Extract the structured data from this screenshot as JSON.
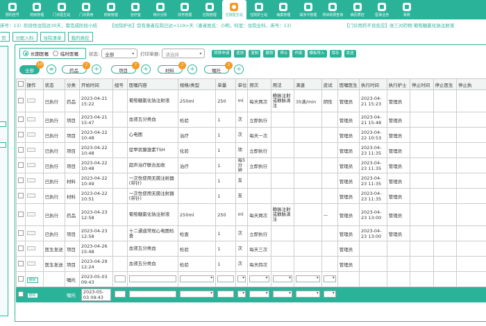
{
  "nav": [
    {
      "label": "预约挂号",
      "active": false
    },
    {
      "label": "药房管理",
      "active": false
    },
    {
      "label": "门诊医生站",
      "active": false
    },
    {
      "label": "门诊费用",
      "active": false
    },
    {
      "label": "药房管理",
      "active": false
    },
    {
      "label": "治疗室",
      "active": false
    },
    {
      "label": "统计分析",
      "active": false
    },
    {
      "label": "财务管理",
      "active": false
    },
    {
      "label": "住院管理",
      "active": false
    },
    {
      "label": "住院医生站",
      "active": true
    },
    {
      "label": "住院护士站",
      "active": false
    },
    {
      "label": "病案管理",
      "active": false
    },
    {
      "label": "减涉卡管理",
      "active": false
    },
    {
      "label": "项目收费查询",
      "active": false
    },
    {
      "label": "病历质控",
      "active": false
    },
    {
      "label": "医保业务",
      "active": false
    },
    {
      "label": "系统",
      "active": false
    }
  ],
  "ticker": {
    "msg1": "床号：13）阶段性往院达30天，需完成阶段小结",
    "msg2": "【住院护长】您有患者在院已达<119>天（患者姓名：小明，科室：住院全科，床号：13）",
    "msg3": "【门诊用药不良反应】张三对药物:葡萄糖氯化钠注射液"
  },
  "toolbar": [
    "页",
    "分配入科",
    "住院清单",
    "我的质控"
  ],
  "filter": {
    "long_term": "长期医嘱",
    "temporary": "临时医嘱",
    "status_label": "状态:",
    "status_value": "全部",
    "print_label": "打印单据:",
    "print_placeholder": "请选择",
    "actions": [
      "转移申请",
      "医技",
      "复制",
      "撤销",
      "停止",
      "作废",
      "模板导入",
      "保存",
      "发送"
    ]
  },
  "pills": {
    "all": {
      "label": "全部",
      "count": "13"
    },
    "drug": {
      "label": "药品",
      "count": "2"
    },
    "item": {
      "label": "项目",
      "count": "7"
    },
    "material": {
      "label": "材料",
      "count": "2"
    },
    "entrust": {
      "label": "嘱托",
      "count": "2"
    }
  },
  "columns": [
    "操作",
    "状态",
    "分类",
    "开始时间",
    "组号",
    "医嘱内容",
    "规格/类型",
    "单量",
    "单位",
    "频次",
    "用法",
    "滴速",
    "皮试",
    "医嘱医生",
    "执行时间",
    "执行护士",
    "停止时间",
    "停止医生",
    "停止执"
  ],
  "rows": [
    {
      "status": "已执行",
      "category": "药品",
      "start": "2023-04-21 15:22",
      "content": "葡萄糖氯化钠注射液",
      "spec": "250ml",
      "qty": "250",
      "unit": "ml",
      "freq": "每天两次",
      "usage": "静脉注射或静脉滴注",
      "speed": "35滴/min",
      "skin": "阴性",
      "doctor": "管理员",
      "exec_time": "2023-04-21 15:23",
      "nurse": "管理员"
    },
    {
      "status": "已执行",
      "category": "项目",
      "start": "2023-04-21 15:47",
      "content": "血液五分类血",
      "spec": "检验",
      "qty": "1",
      "unit": "次",
      "freq": "立即执行",
      "usage": "",
      "speed": "",
      "skin": "",
      "doctor": "管理员",
      "exec_time": "2023-04-21 15:48",
      "nurse": "管理员"
    },
    {
      "status": "已执行",
      "category": "项目",
      "start": "2023-04-22 10:48",
      "content": "心电图",
      "spec": "治疗",
      "qty": "1",
      "unit": "次",
      "freq": "每天一次",
      "usage": "",
      "speed": "",
      "skin": "",
      "doctor": "管理员",
      "exec_time": "2023-04-22 10:53",
      "nurse": "管理员"
    },
    {
      "status": "已执行",
      "category": "项目",
      "start": "2023-04-22 10:48",
      "content": "促甲状腺激素TSH",
      "spec": "化验",
      "qty": "1",
      "unit": "项",
      "freq": "立即执行",
      "usage": "",
      "speed": "",
      "skin": "",
      "doctor": "管理员",
      "exec_time": "2023-04-23 11:35",
      "nurse": "管理员"
    },
    {
      "status": "已执行",
      "category": "项目",
      "start": "2023-04-22 10:48",
      "content": "超声治疗联合加收",
      "spec": "治疗",
      "qty": "1",
      "unit": "每5分钟",
      "freq": "立即执行",
      "usage": "",
      "speed": "",
      "skin": "",
      "doctor": "管理员",
      "exec_time": "2023-04-23 11:35",
      "nurse": "管理员"
    },
    {
      "status": "已执行",
      "category": "材料",
      "start": "2023-04-22 10:49",
      "content": "一次性使用无菌注射器(带针)",
      "spec": "",
      "qty": "1",
      "unit": "支",
      "freq": "",
      "usage": "",
      "speed": "",
      "skin": "",
      "doctor": "管理员",
      "exec_time": "2023-04-23 11:35",
      "nurse": "管理员"
    },
    {
      "status": "已执行",
      "category": "材料",
      "start": "2023-04-22 10:51",
      "content": "一次性使用无菌注射器(带针)",
      "spec": "",
      "qty": "1",
      "unit": "支",
      "freq": "",
      "usage": "",
      "speed": "",
      "skin": "",
      "doctor": "管理员",
      "exec_time": "2023-04-23 11:35",
      "nurse": "管理员"
    },
    {
      "status": "已执行",
      "category": "药品",
      "start": "2023-04-23 12:58",
      "content": "葡萄糖氯化钠注射液",
      "spec": "250ml",
      "qty": "250",
      "unit": "ml",
      "freq": "每天两次",
      "usage": "静脉注射或静脉滴注",
      "speed": "",
      "skin": "—",
      "doctor": "管理员",
      "exec_time": "2023-04-23 13:00",
      "nurse": "管理员"
    },
    {
      "status": "已执行",
      "category": "项目",
      "start": "2023-04-23 12:58",
      "content": "十二通道常规心电图检查",
      "spec": "检查",
      "qty": "1",
      "unit": "次",
      "freq": "立即执行",
      "usage": "",
      "speed": "",
      "skin": "",
      "doctor": "管理员",
      "exec_time": "2023-04-23 13:00",
      "nurse": "管理员"
    },
    {
      "status": "医生发送",
      "category": "项目",
      "start": "2023-04-26 15:48",
      "content": "血液五分类血",
      "spec": "检验",
      "qty": "1",
      "unit": "次",
      "freq": "每天三次",
      "usage": "",
      "speed": "",
      "skin": "",
      "doctor": "管理员",
      "exec_time": "",
      "nurse": ""
    },
    {
      "status": "医生发送",
      "category": "项目",
      "start": "2023-04-29 12:24",
      "content": "血液五分类血",
      "spec": "检验",
      "qty": "1",
      "unit": "次",
      "freq": "每天四次",
      "usage": "",
      "speed": "",
      "skin": "",
      "doctor": "管理员",
      "exec_time": "",
      "nurse": ""
    }
  ],
  "new_rows": [
    {
      "action": "删除",
      "category": "嘱托",
      "start": "2023-05-03 09:43"
    },
    {
      "action": "删除",
      "category": "嘱托",
      "start": "2023-05-03 09:43"
    }
  ]
}
